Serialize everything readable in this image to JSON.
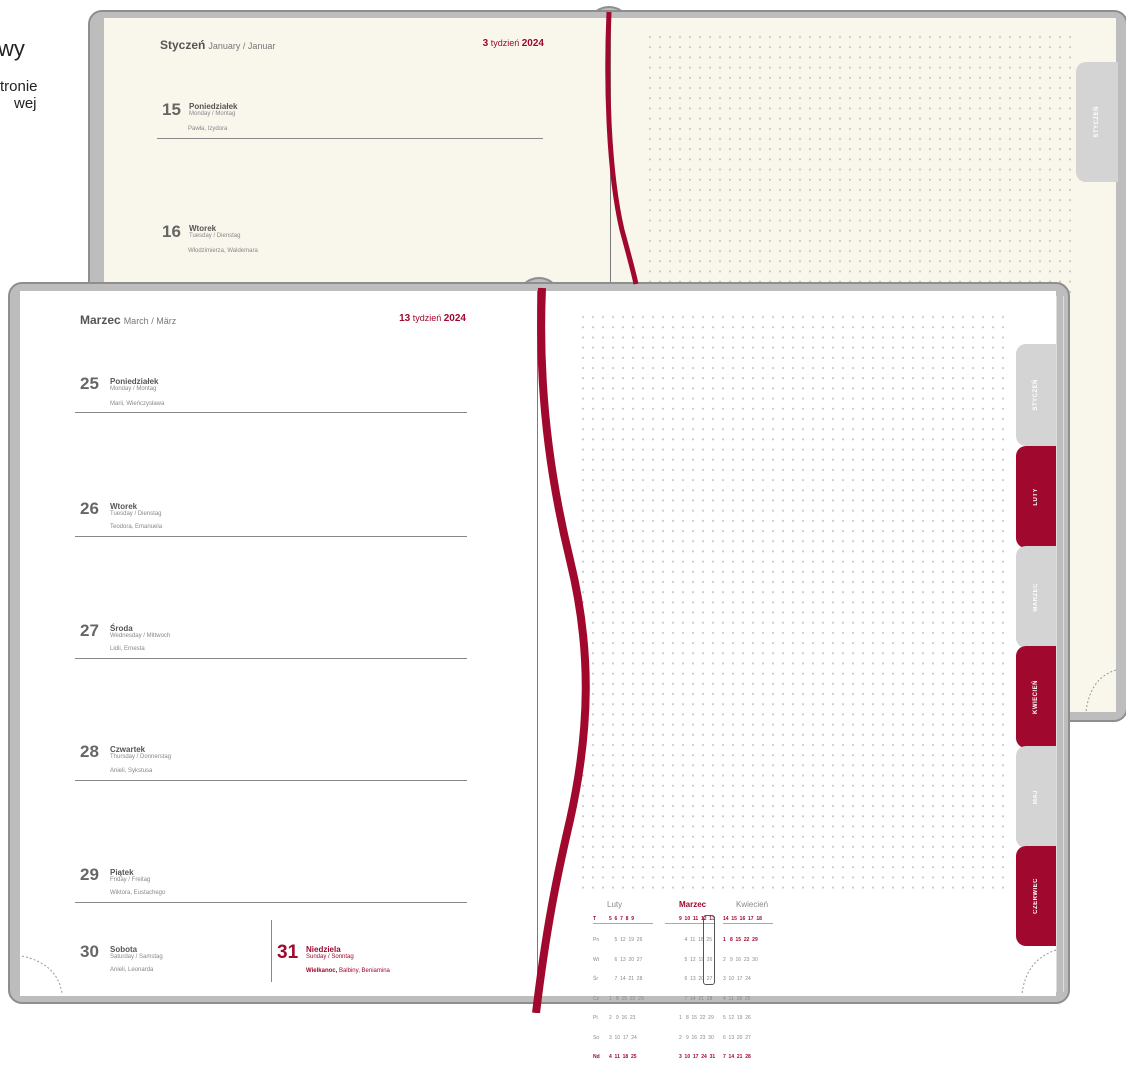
{
  "left_text": [
    "wy",
    "tronie",
    "wej"
  ],
  "back": {
    "month": "Styczeń",
    "month_sub": "January / Januar",
    "week_num": "3",
    "week_word": "tydzień",
    "year": "2024",
    "days": [
      {
        "num": "15",
        "name": "Poniedziałek",
        "sub": "Monday / Montag",
        "names": "Pawła, Izydora"
      },
      {
        "num": "16",
        "name": "Wtorek",
        "sub": "Tuesday / Dienstag",
        "names": "Włodzimierza, Waldemara"
      }
    ],
    "tab": "STYCZEŃ"
  },
  "front": {
    "month": "Marzec",
    "month_sub": "March / März",
    "week_num": "13",
    "week_word": "tydzień",
    "year": "2024",
    "days": [
      {
        "num": "25",
        "name": "Poniedziałek",
        "sub": "Monday / Montag",
        "names": "Marii, Wieńczysława"
      },
      {
        "num": "26",
        "name": "Wtorek",
        "sub": "Tuesday / Dienstag",
        "names": "Teodora, Emanuela"
      },
      {
        "num": "27",
        "name": "Środa",
        "sub": "Wednesday / Mittwoch",
        "names": "Lidii, Ernesta"
      },
      {
        "num": "28",
        "name": "Czwartek",
        "sub": "Thursday / Donnerstag",
        "names": "Anieli, Sykstusa"
      },
      {
        "num": "29",
        "name": "Piątek",
        "sub": "Friday / Freitag",
        "names": "Wiktora, Eustachego"
      }
    ],
    "sat": {
      "num": "30",
      "name": "Sobota",
      "sub": "Saturday / Samstag",
      "names": "Anieli, Leonarda"
    },
    "sun": {
      "num": "31",
      "name": "Niedziela",
      "sub": "Sunday / Sonntag",
      "holiday": "Wielkanoc,",
      "names": "Balbiny, Beniamina"
    },
    "tabs": [
      {
        "label": "STYCZEŃ",
        "color": "grey"
      },
      {
        "label": "LUTY",
        "color": "red"
      },
      {
        "label": "MARZEC",
        "color": "grey"
      },
      {
        "label": "KWIECIEŃ",
        "color": "red"
      },
      {
        "label": "MAJ",
        "color": "grey"
      },
      {
        "label": "CZERWIEC",
        "color": "red"
      }
    ],
    "mini_cal": {
      "months": [
        "Luty",
        "Marzec",
        "Kwiecień"
      ],
      "weeks_luty": "5  6  7  8  9",
      "weeks_marzec": "9  10  11  12  13",
      "weeks_kwiecien": "14  15  16  17  18",
      "day_labels": [
        "T",
        "Pn",
        "Wt",
        "Śr",
        "Cz",
        "Pt",
        "So",
        "Nd"
      ],
      "luty_rows": [
        "    5  12  19  26",
        "    6  13  20  27",
        "    7  14  21  28",
        "1   8  15  22  29",
        "2   9  16  23",
        "3  10  17  24",
        "4  11  18  25"
      ],
      "marzec_rows": [
        "    4  11  18  25",
        "    5  12  19  26",
        "    6  13  20  27",
        "    7  14  21  28",
        "1   8  15  22  29",
        "2   9  16  23  30",
        "3  10  17  24  31"
      ],
      "kwiecien_rows": [
        "1   8  15  22  29",
        "2   9  16  23  30",
        "3  10  17  24",
        "4  11  18  25",
        "5  12  19  26",
        "6  13  20  27",
        "7  14  21  28"
      ]
    }
  },
  "colors": {
    "accent": "#a0082d",
    "back_page": "#f9f6ec",
    "cover": "#bdbdbd"
  }
}
